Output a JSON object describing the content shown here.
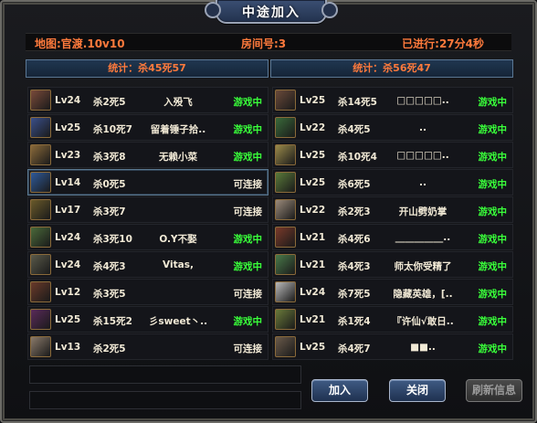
{
  "window": {
    "title": "中途加入"
  },
  "info": {
    "map": "地图:官渡.10v10",
    "room": "房间号:3",
    "elapsed": "已进行:27分4秒"
  },
  "stats": {
    "left": "统计：杀45死57",
    "right": "统计：杀56死47"
  },
  "status_colors": {
    "playing": "#39ff3a",
    "open": "#f2ead6"
  },
  "teams": {
    "left": [
      {
        "level": "Lv24",
        "kd": "杀2死5",
        "name": "入殁飞",
        "status": "游戏中",
        "state": "playing",
        "avatar_color": "#7a4a3a"
      },
      {
        "level": "Lv25",
        "kd": "杀10死7",
        "name": "留着锤子拾..",
        "status": "游戏中",
        "state": "playing",
        "avatar_color": "#3a4f8a"
      },
      {
        "level": "Lv23",
        "kd": "杀3死8",
        "name": "无赖小菜",
        "status": "游戏中",
        "state": "playing",
        "avatar_color": "#8a6a3a"
      },
      {
        "level": "Lv14",
        "kd": "杀0死5",
        "name": "",
        "status": "可连接",
        "state": "open",
        "avatar_color": "#2f5a9a"
      },
      {
        "level": "Lv17",
        "kd": "杀3死7",
        "name": "",
        "status": "可连接",
        "state": "open",
        "avatar_color": "#6a5a2a"
      },
      {
        "level": "Lv24",
        "kd": "杀3死10",
        "name": "O.Y不娶",
        "status": "游戏中",
        "state": "playing",
        "avatar_color": "#4a6a3a"
      },
      {
        "level": "Lv24",
        "kd": "杀4死3",
        "name": "Vitas,",
        "status": "游戏中",
        "state": "playing",
        "avatar_color": "#5a5a4a"
      },
      {
        "level": "Lv12",
        "kd": "杀3死5",
        "name": "",
        "status": "可连接",
        "state": "open",
        "avatar_color": "#6a3a2a"
      },
      {
        "level": "Lv25",
        "kd": "杀15死2",
        "name": "彡sweet丶..",
        "status": "游戏中",
        "state": "playing",
        "avatar_color": "#5a2a5a"
      },
      {
        "level": "Lv13",
        "kd": "杀2死5",
        "name": "",
        "status": "可连接",
        "state": "open",
        "avatar_color": "#8a7a6a"
      }
    ],
    "right": [
      {
        "level": "Lv25",
        "kd": "杀14死5",
        "name": "□□□□□..",
        "status": "游戏中",
        "state": "playing",
        "avatar_color": "#6a4a3a"
      },
      {
        "level": "Lv22",
        "kd": "杀4死5",
        "name": "..",
        "status": "游戏中",
        "state": "playing",
        "avatar_color": "#3a6a3a"
      },
      {
        "level": "Lv25",
        "kd": "杀10死4",
        "name": "□□□□□..",
        "status": "游戏中",
        "state": "playing",
        "avatar_color": "#9a8a4a"
      },
      {
        "level": "Lv25",
        "kd": "杀6死5",
        "name": "..",
        "status": "游戏中",
        "state": "playing",
        "avatar_color": "#5a7a3a"
      },
      {
        "level": "Lv22",
        "kd": "杀2死3",
        "name": "开山劈奶掌",
        "status": "游戏中",
        "state": "playing",
        "avatar_color": "#9a8a7a"
      },
      {
        "level": "Lv21",
        "kd": "杀4死6",
        "name": "__________..",
        "status": "游戏中",
        "state": "playing",
        "avatar_color": "#7a3a2a"
      },
      {
        "level": "Lv21",
        "kd": "杀4死3",
        "name": "师太你受精了",
        "status": "游戏中",
        "state": "playing",
        "avatar_color": "#4a7a4a"
      },
      {
        "level": "Lv24",
        "kd": "杀7死5",
        "name": "隐藏英雄，[..",
        "status": "游戏中",
        "state": "playing",
        "avatar_color": "#bababa"
      },
      {
        "level": "Lv21",
        "kd": "杀1死4",
        "name": "『许仙√敢日..",
        "status": "游戏中",
        "state": "playing",
        "avatar_color": "#6a7a3a"
      },
      {
        "level": "Lv25",
        "kd": "杀4死7",
        "name": "■■..",
        "status": "游戏中",
        "state": "playing",
        "avatar_color": "#6a5a4a"
      }
    ]
  },
  "buttons": {
    "join": "加入",
    "close": "关闭",
    "refresh": "刷新信息"
  }
}
